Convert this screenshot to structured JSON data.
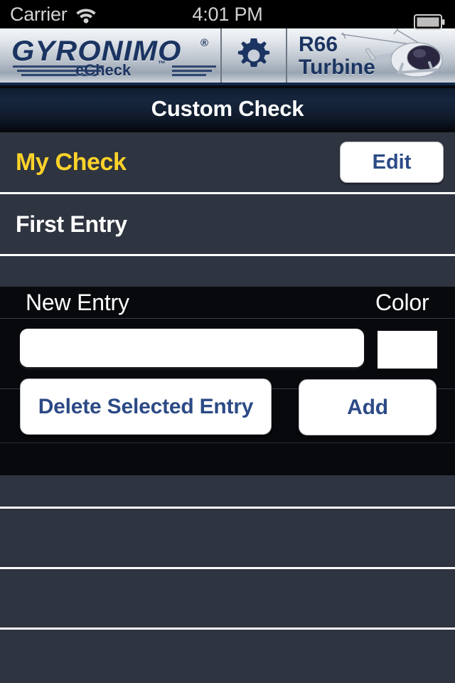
{
  "status_bar": {
    "carrier": "Carrier",
    "time": "4:01 PM",
    "wifi_icon": "wifi-icon",
    "battery_icon": "battery-icon"
  },
  "brand_header": {
    "logo_primary": "GYRONIMO",
    "logo_registered": "®",
    "logo_secondary": "eCheck",
    "logo_trademark": "™",
    "gear_icon": "gear-icon",
    "model_line1": "R66",
    "model_line2": "Turbine",
    "helicopter_icon": "helicopter-icon"
  },
  "title_bar": {
    "title": "Custom Check"
  },
  "top_list": {
    "check_name": "My Check",
    "edit_label": "Edit",
    "entries": [
      {
        "label": "First Entry"
      }
    ]
  },
  "form": {
    "new_entry_label": "New Entry",
    "color_label": "Color",
    "new_entry_value": "",
    "new_entry_placeholder": "",
    "color_value": "#FFFFFF",
    "delete_label": "Delete Selected Entry",
    "add_label": "Add"
  },
  "bottom_list": {
    "rows": [
      "",
      "",
      "",
      ""
    ]
  },
  "colors": {
    "accent_yellow": "#FFD32A",
    "button_text_navy": "#2C4A86",
    "row_slate": "#2E3440",
    "background_black": "#08090D",
    "brand_navy": "#1B3461"
  }
}
